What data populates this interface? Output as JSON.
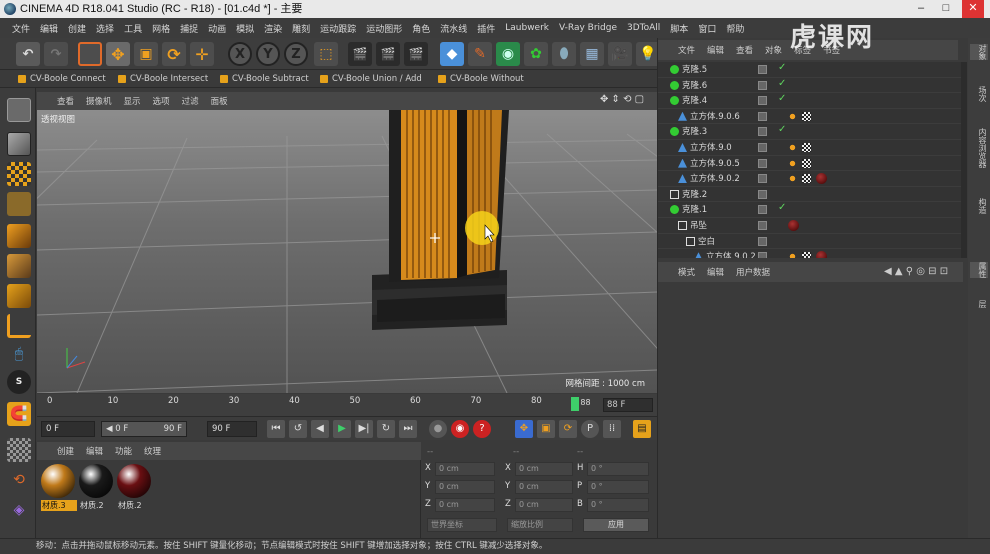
{
  "window": {
    "title": "CINEMA 4D R18.041 Studio (RC - R18) - [01.c4d *] - 主要"
  },
  "menu": [
    "文件",
    "编辑",
    "创建",
    "选择",
    "工具",
    "网格",
    "捕捉",
    "动画",
    "模拟",
    "渲染",
    "雕刻",
    "运动跟踪",
    "运动图形",
    "角色",
    "流水线",
    "插件",
    "Laubwerk",
    "V-Ray Bridge",
    "3DToAll",
    "脚本",
    "窗口",
    "帮助"
  ],
  "plugins": [
    "CV-Boole Connect",
    "CV-Boole Intersect",
    "CV-Boole Subtract",
    "CV-Boole Union / Add",
    "CV-Boole Without"
  ],
  "viewport": {
    "menu": [
      "查看",
      "摄像机",
      "显示",
      "选项",
      "过滤",
      "面板"
    ],
    "label": "透视视图",
    "grid_label": "网格间距 : 1000 cm"
  },
  "timeline": {
    "ticks": [
      "0",
      "10",
      "20",
      "30",
      "40",
      "50",
      "60",
      "70",
      "80"
    ],
    "marker_label": "88",
    "end_frame": "88 F",
    "current_frame": 88,
    "max_frame": 90
  },
  "playback": {
    "start_field": "0 F",
    "range_start": "◀ 0 F",
    "range_end": "90 F",
    "end_field": "90 F"
  },
  "materials": {
    "menu": [
      "创建",
      "编辑",
      "功能",
      "纹理"
    ],
    "items": [
      {
        "label": "材质.3",
        "color": "#c07a1a",
        "selected": true
      },
      {
        "label": "材质.2",
        "color": "#1a1a1a",
        "selected": false
      },
      {
        "label": "材质.2",
        "color": "#6a0f12",
        "selected": false
      }
    ]
  },
  "coords": {
    "headers": [
      "--",
      "--",
      "--"
    ],
    "rows": [
      {
        "a": "X",
        "av": "0 cm",
        "b": "X",
        "bv": "0 cm",
        "c": "H",
        "cv": "0 °"
      },
      {
        "a": "Y",
        "av": "0 cm",
        "b": "Y",
        "bv": "0 cm",
        "c": "P",
        "cv": "0 °"
      },
      {
        "a": "Z",
        "av": "0 cm",
        "b": "Z",
        "bv": "0 cm",
        "c": "B",
        "cv": "0 °"
      }
    ],
    "mode": "世界坐标",
    "scale": "缩放比例",
    "apply": "应用"
  },
  "objects": {
    "menu": [
      "文件",
      "编辑",
      "查看",
      "对象",
      "标签",
      "书签"
    ],
    "rows": [
      {
        "name": "克隆.5",
        "indent": 0,
        "icon": "cloner-icon",
        "check": "✓",
        "tags": []
      },
      {
        "name": "克隆.6",
        "indent": 0,
        "icon": "cloner-icon",
        "check": "✓",
        "tags": []
      },
      {
        "name": "克隆.4",
        "indent": 0,
        "icon": "cloner-icon",
        "check": "✓",
        "tags": []
      },
      {
        "name": "立方体.9.0.6",
        "indent": 1,
        "icon": "cube-icon",
        "check": "",
        "tags": [
          "phong",
          "checker"
        ]
      },
      {
        "name": "克隆.3",
        "indent": 0,
        "icon": "cloner-icon",
        "check": "✓",
        "tags": []
      },
      {
        "name": "立方体.9.0",
        "indent": 1,
        "icon": "cube-icon",
        "check": "",
        "tags": [
          "phong",
          "checker"
        ]
      },
      {
        "name": "立方体.9.0.5",
        "indent": 1,
        "icon": "cube-icon",
        "check": "",
        "tags": [
          "phong",
          "checker"
        ]
      },
      {
        "name": "立方体.9.0.2",
        "indent": 1,
        "icon": "cube-icon",
        "check": "",
        "tags": [
          "phong",
          "checker",
          "material"
        ]
      },
      {
        "name": "克隆.2",
        "indent": 0,
        "icon": "null-icon",
        "check": "",
        "tags": []
      },
      {
        "name": "克隆.1",
        "indent": 0,
        "icon": "cloner-icon",
        "check": "✓",
        "tags": []
      },
      {
        "name": "吊坠",
        "indent": 1,
        "icon": "null-icon",
        "check": "",
        "tags": [
          "material"
        ]
      },
      {
        "name": "空白",
        "indent": 2,
        "icon": "null-icon",
        "check": "",
        "tags": []
      },
      {
        "name": "立方体.9.0.2",
        "indent": 3,
        "icon": "cube-icon",
        "check": "",
        "tags": [
          "phong",
          "checker",
          "material"
        ]
      }
    ]
  },
  "attributes": {
    "menu": [
      "模式",
      "编辑",
      "用户数据"
    ]
  },
  "side_tabs": [
    "对象",
    "场次",
    "内容浏览器",
    "构造",
    "属性",
    "层"
  ],
  "status": "移动：点击并拖动鼠标移动元素。按住 SHIFT 键量化移动；节点编辑模式时按住 SHIFT 键增加选择对象；按住 CTRL 键减少选择对象。",
  "watermark": "虎课网",
  "colors": {
    "accent": "#e6a21b",
    "check": "#5fd35f",
    "cursor": "#f4d21a"
  }
}
